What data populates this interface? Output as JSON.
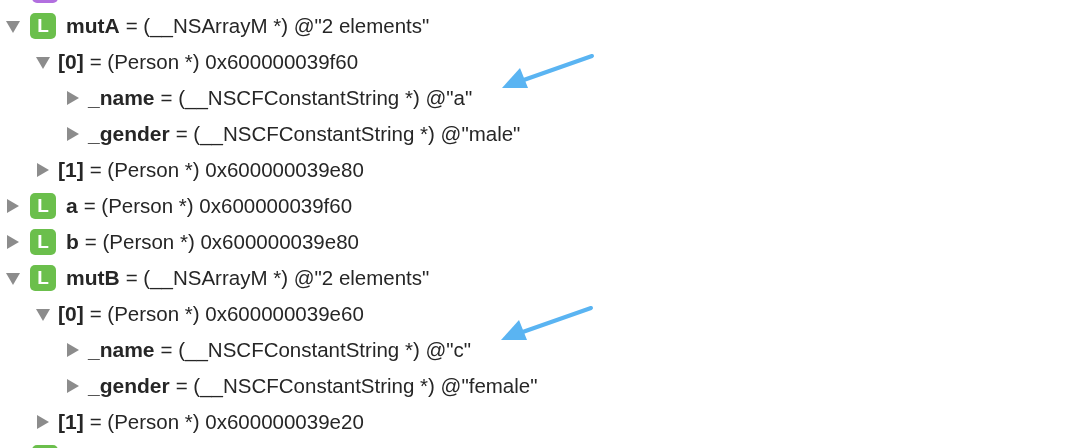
{
  "variables": [
    {
      "kind": "cut",
      "color": "#b26fdf"
    },
    {
      "kind": "variable",
      "badge": "L",
      "color": "#6bbf4c",
      "name": "mutA",
      "value": "= (__NSArrayM *) @\"2 elements\"",
      "expanded": true,
      "children": [
        {
          "kind": "element",
          "name": "[0]",
          "value": "= (Person *) 0x600000039f60",
          "expanded": true,
          "children": [
            {
              "kind": "element",
              "name": "_name",
              "value": "= (__NSCFConstantString *) @\"a\"",
              "expanded": false,
              "arrow": true
            },
            {
              "kind": "element",
              "name": "_gender",
              "value": "= (__NSCFConstantString *) @\"male\"",
              "expanded": false,
              "arrow": false
            }
          ]
        },
        {
          "kind": "element",
          "name": "[1]",
          "value": "= (Person *) 0x600000039e80",
          "expanded": false
        }
      ]
    },
    {
      "kind": "variable",
      "badge": "L",
      "color": "#6bbf4c",
      "name": "a",
      "value": "= (Person *) 0x600000039f60",
      "expanded": false
    },
    {
      "kind": "variable",
      "badge": "L",
      "color": "#6bbf4c",
      "name": "b",
      "value": "= (Person *) 0x600000039e80",
      "expanded": false
    },
    {
      "kind": "variable",
      "badge": "L",
      "color": "#6bbf4c",
      "name": "mutB",
      "value": "= (__NSArrayM *) @\"2 elements\"",
      "expanded": true,
      "children": [
        {
          "kind": "element",
          "name": "[0]",
          "value": "= (Person *) 0x600000039e60",
          "expanded": true,
          "children": [
            {
              "kind": "element",
              "name": "_name",
              "value": "= (__NSCFConstantString *) @\"c\"",
              "expanded": false,
              "arrow": true
            },
            {
              "kind": "element",
              "name": "_gender",
              "value": "= (__NSCFConstantString *) @\"female\"",
              "expanded": false,
              "arrow": false
            }
          ]
        },
        {
          "kind": "element",
          "name": "[1]",
          "value": "= (Person *) 0x600000039e20",
          "expanded": false
        }
      ]
    },
    {
      "kind": "cut",
      "color": "#6bbf4c"
    }
  ]
}
